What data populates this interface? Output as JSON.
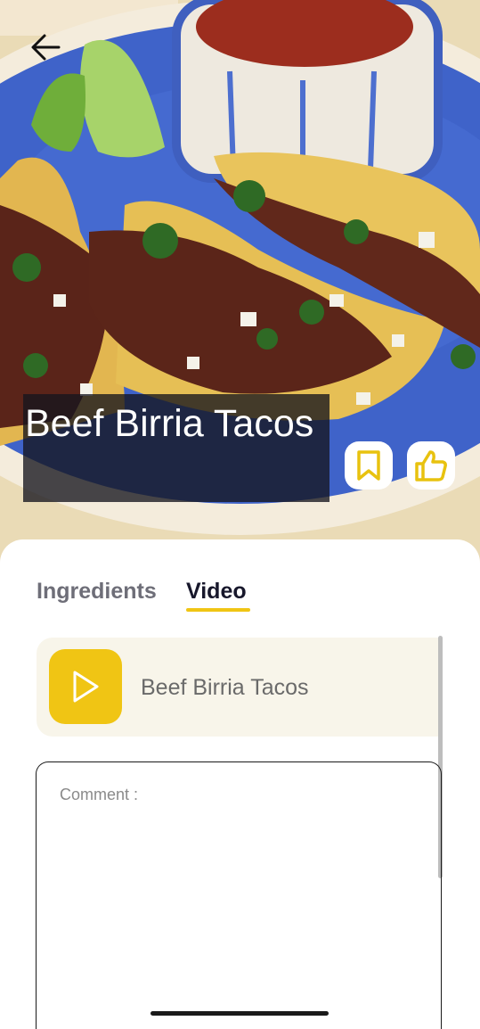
{
  "header": {
    "back_icon": "arrow-left-icon",
    "title": "Beef Birria Tacos",
    "bookmark_icon": "bookmark-icon",
    "like_icon": "thumbs-up-icon"
  },
  "tabs": [
    {
      "label": "Ingredients",
      "active": false
    },
    {
      "label": "Video",
      "active": true
    }
  ],
  "video": {
    "play_icon": "play-icon",
    "title": "Beef Birria Tacos"
  },
  "comment": {
    "placeholder": "Comment :",
    "value": ""
  },
  "colors": {
    "accent": "#f0c514",
    "card_bg": "#f8f5ea",
    "title_overlay": "#14141e",
    "plate": "#3f63c9"
  }
}
